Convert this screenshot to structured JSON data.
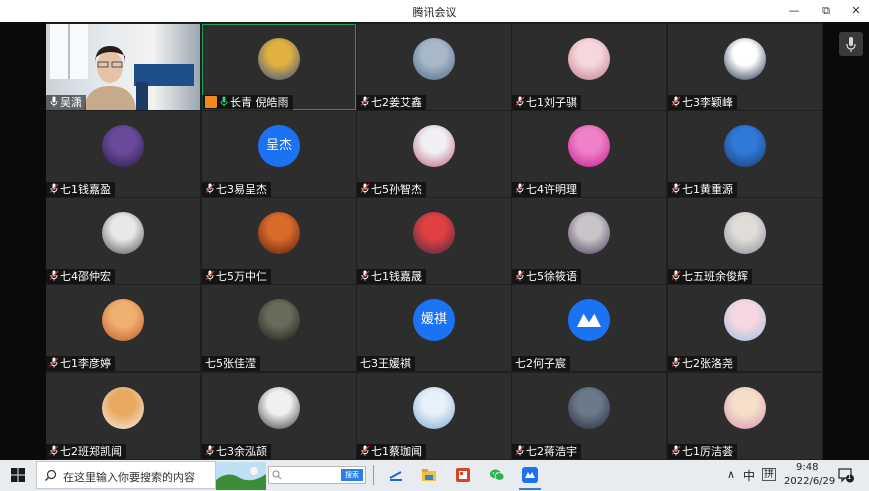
{
  "window": {
    "title": "腾讯会议",
    "minimize_label": "—",
    "maximize_label": "⧉",
    "close_label": "✕"
  },
  "participants": [
    {
      "name": "吴潇",
      "avatar_type": "camera"
    },
    {
      "name": "长青 倪皓雨",
      "avatar_type": "photo",
      "host": true,
      "active": true,
      "colors": [
        "#e0b040",
        "#2f4c8a"
      ]
    },
    {
      "name": "七2姜艾鑫",
      "avatar_type": "photo",
      "colors": [
        "#a8b8c8",
        "#4c6a8a"
      ]
    },
    {
      "name": "七1刘子骐",
      "avatar_type": "photo",
      "colors": [
        "#f5d7dd",
        "#c47a88"
      ]
    },
    {
      "name": "七3李颖峰",
      "avatar_type": "photo",
      "colors": [
        "#ffffff",
        "#1c2a48"
      ]
    },
    {
      "name": "七1钱嘉盈",
      "avatar_type": "photo",
      "colors": [
        "#6a4a9a",
        "#2a1a4a"
      ]
    },
    {
      "name": "七3易呈杰",
      "avatar_type": "text",
      "initials": "呈杰"
    },
    {
      "name": "七5孙智杰",
      "avatar_type": "photo",
      "colors": [
        "#f0f0f4",
        "#b9617a"
      ]
    },
    {
      "name": "七4许明理",
      "avatar_type": "photo",
      "colors": [
        "#f080c8",
        "#c01e8a"
      ]
    },
    {
      "name": "七1黄重源",
      "avatar_type": "photo",
      "colors": [
        "#2f7ad8",
        "#1a3a6a"
      ]
    },
    {
      "name": "七4邵仲宏",
      "avatar_type": "photo",
      "colors": [
        "#e8e8e8",
        "#505050"
      ]
    },
    {
      "name": "七5万中仁",
      "avatar_type": "photo",
      "colors": [
        "#d86a2a",
        "#5a1a10"
      ]
    },
    {
      "name": "七1钱嘉晟",
      "avatar_type": "photo",
      "colors": [
        "#e04040",
        "#3a2a4a"
      ]
    },
    {
      "name": "七5徐筱语",
      "avatar_type": "photo",
      "colors": [
        "#c8c4c8",
        "#4a3a5a"
      ]
    },
    {
      "name": "七五班余俊辉",
      "avatar_type": "photo",
      "colors": [
        "#e0dcd8",
        "#8a8a9a"
      ]
    },
    {
      "name": "七1李彦婷",
      "avatar_type": "photo",
      "colors": [
        "#f0b070",
        "#c05a2a"
      ]
    },
    {
      "name": "七5张佳滢",
      "avatar_type": "photo",
      "colors": [
        "#6a6a5a",
        "#1a1a1a"
      ]
    },
    {
      "name": "七3王媛祺",
      "avatar_type": "text",
      "initials": "媛祺"
    },
    {
      "name": "七2何子宸",
      "avatar_type": "logo"
    },
    {
      "name": "七2张洛尧",
      "avatar_type": "photo",
      "colors": [
        "#f8d8e0",
        "#9ac0e0"
      ]
    },
    {
      "name": "七2班郑凯闻",
      "avatar_type": "photo",
      "colors": [
        "#e8a860",
        "#f4f0ea"
      ]
    },
    {
      "name": "七3余泓颉",
      "avatar_type": "photo",
      "colors": [
        "#f0f0f0",
        "#3a3a3a"
      ]
    },
    {
      "name": "七1蔡珈闻",
      "avatar_type": "photo",
      "colors": [
        "#e8f0f8",
        "#7aa8d0"
      ]
    },
    {
      "name": "七2蒋浩宇",
      "avatar_type": "photo",
      "colors": [
        "#6a7a8a",
        "#2a2a3a"
      ]
    },
    {
      "name": "七1厉洁荟",
      "avatar_type": "photo",
      "colors": [
        "#f4e0c8",
        "#d890b8"
      ]
    }
  ],
  "taskbar": {
    "search_placeholder": "在这里输入你要搜索的内容",
    "mini_search_button": "搜索",
    "ime_label": "中",
    "ime_mode": "拼",
    "tray_chevron": "∧",
    "time": "9:48",
    "date": "2022/6/29",
    "notification_count": "1"
  },
  "colors": {
    "accent_blue": "#1b72f2",
    "active_border": "#1f9e55",
    "host_badge": "#f08a1c",
    "mic_green": "#2bd46a"
  }
}
